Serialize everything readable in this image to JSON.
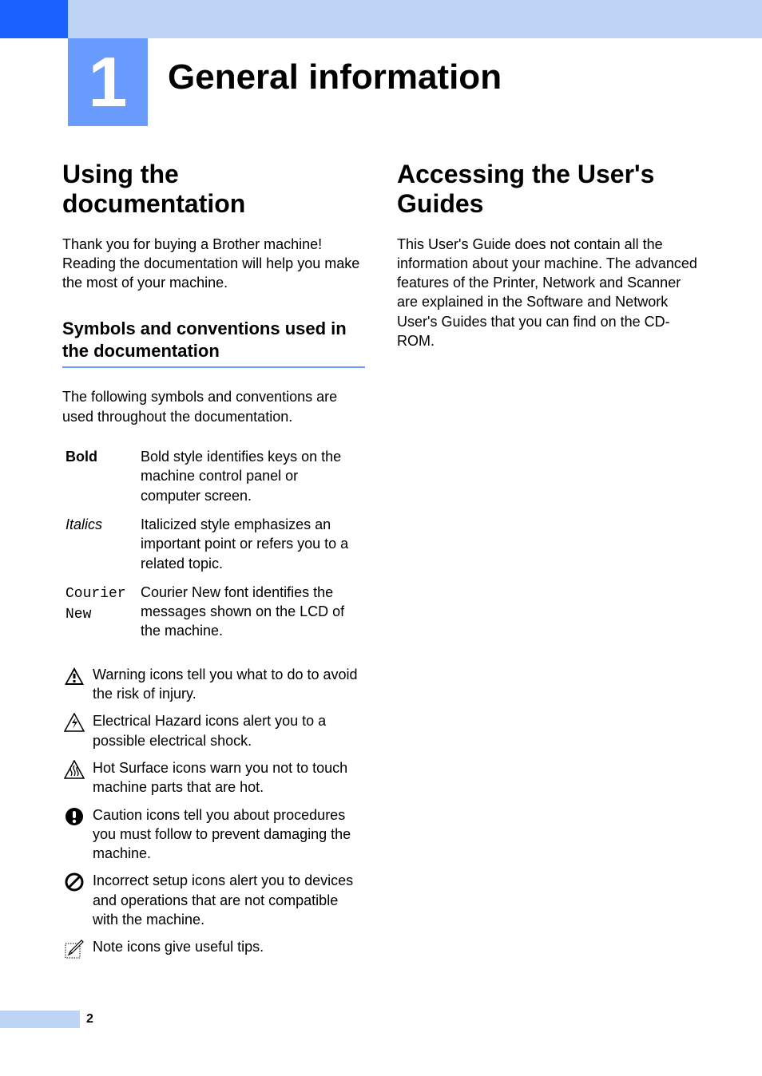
{
  "chapter": {
    "number": "1",
    "title": "General information"
  },
  "left": {
    "h1": "Using the documentation",
    "intro": "Thank you for buying a Brother machine! Reading the documentation will help you make the most of your machine.",
    "h2": "Symbols and conventions used in the documentation",
    "sub_intro": "The following symbols and conventions are used throughout the documentation.",
    "defs": [
      {
        "term": "Bold",
        "termClass": "term-bold",
        "text": "Bold style identifies keys on the machine control panel or computer screen."
      },
      {
        "term": "Italics",
        "termClass": "term-italic",
        "text": "Italicized style emphasizes an important point or refers you to a related topic."
      },
      {
        "term": "Courier New",
        "termClass": "term-mono",
        "text": "Courier New font identifies the messages shown on the LCD of the machine."
      }
    ],
    "icons": [
      {
        "name": "warning-icon",
        "text": "Warning icons tell you what to do to avoid the risk of injury."
      },
      {
        "name": "electrical-hazard-icon",
        "text": "Electrical Hazard icons alert you to a possible electrical shock."
      },
      {
        "name": "hot-surface-icon",
        "text": "Hot Surface icons warn you not to touch machine parts that are hot."
      },
      {
        "name": "caution-icon",
        "text": "Caution icons tell you about procedures you must follow to prevent damaging the machine."
      },
      {
        "name": "incorrect-setup-icon",
        "text": "Incorrect setup icons alert you to devices and operations that are not compatible with the machine."
      },
      {
        "name": "note-icon",
        "text": "Note icons give useful tips."
      }
    ]
  },
  "right": {
    "h1": "Accessing the User's Guides",
    "p": "This User's Guide does not contain all the information about your machine. The advanced features of the Printer, Network and Scanner are explained in the Software and Network User's Guides that you can find on the CD-ROM."
  },
  "page_number": "2"
}
